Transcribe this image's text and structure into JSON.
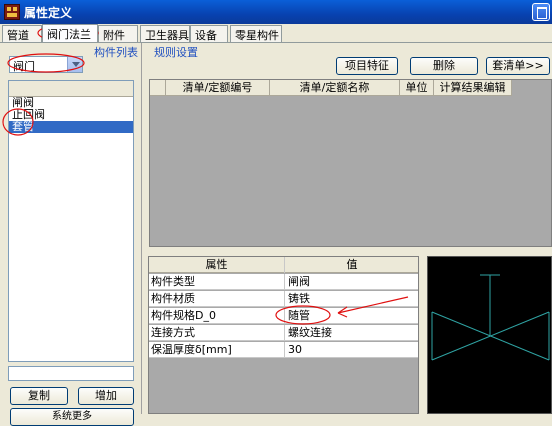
{
  "window": {
    "title": "属性定义"
  },
  "tabs": [
    {
      "label": "管道"
    },
    {
      "label": "阀门法兰"
    },
    {
      "label": "附件"
    },
    {
      "label": "卫生器具"
    },
    {
      "label": "设备"
    },
    {
      "label": "零星构件"
    }
  ],
  "left": {
    "section_label": "构件列表",
    "category_value": "阀门",
    "items": [
      "闸阀",
      "止回阀",
      "套管"
    ],
    "selected_index": 2,
    "copy_label": "复制",
    "add_label": "增加",
    "partial_button_label": "系统更多"
  },
  "right": {
    "section_label": "规则设置",
    "buttons": {
      "item_feature": "项目特征",
      "delete": "删除",
      "apply_list": "套清单>>"
    },
    "grid_columns": [
      "清单/定额编号",
      "清单/定额名称",
      "单位",
      "计算结果编辑"
    ]
  },
  "properties": {
    "headers": {
      "name": "属性",
      "value": "值"
    },
    "rows": [
      {
        "name": "构件类型",
        "value": "闸阀"
      },
      {
        "name": "构件材质",
        "value": "铸铁"
      },
      {
        "name": "构件规格D_0",
        "value": "随管"
      },
      {
        "name": "连接方式",
        "value": "螺纹连接"
      },
      {
        "name": "保温厚度δ[mm]",
        "value": "30"
      }
    ]
  },
  "colors": {
    "annotation": "#e01010",
    "preview_lines": "#2fa3a3",
    "selection": "#316ac5"
  }
}
